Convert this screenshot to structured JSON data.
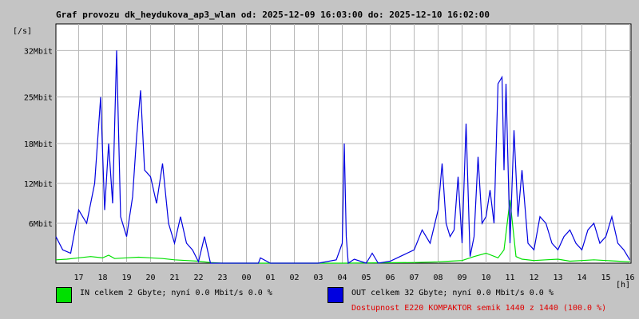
{
  "chart_data": {
    "type": "line",
    "title": "Graf provozu dk_heydukova_ap3_wlan od: 2025-12-09 16:03:00 do: 2025-12-10 16:02:00",
    "ylabel": "[/s]",
    "xlabel": "[h]",
    "ylim": [
      0,
      36
    ],
    "y_unit": "Mbit",
    "y_ticks": [
      {
        "value": 6,
        "label": "6Mbit"
      },
      {
        "value": 12,
        "label": "12Mbit"
      },
      {
        "value": 18,
        "label": "18Mbit"
      },
      {
        "value": 25,
        "label": "25Mbit"
      },
      {
        "value": 32,
        "label": "32Mbit"
      }
    ],
    "x_ticks": [
      "17",
      "18",
      "19",
      "20",
      "21",
      "22",
      "23",
      "00",
      "01",
      "02",
      "03",
      "04",
      "05",
      "06",
      "07",
      "08",
      "09",
      "10",
      "11",
      "12",
      "13",
      "14",
      "15",
      "16"
    ],
    "grid": true,
    "series": [
      {
        "name": "IN",
        "color": "#00e000",
        "x": [
          "16:03",
          "16:30",
          "17:00",
          "17:30",
          "18:00",
          "18:15",
          "18:30",
          "19:00",
          "19:30",
          "20:00",
          "20:30",
          "21:00",
          "21:30",
          "22:00",
          "22:30",
          "23:00",
          "04:00",
          "07:00",
          "08:00",
          "08:30",
          "09:00",
          "09:30",
          "10:00",
          "10:30",
          "10:45",
          "11:00",
          "11:15",
          "11:30",
          "12:00",
          "12:30",
          "13:00",
          "13:30",
          "14:00",
          "14:30",
          "15:00",
          "15:30",
          "16:00"
        ],
        "values": [
          0.5,
          0.6,
          0.8,
          1.0,
          0.8,
          1.2,
          0.7,
          0.8,
          0.9,
          0.8,
          0.7,
          0.5,
          0.4,
          0.3,
          0.1,
          0.0,
          0.0,
          0.1,
          0.2,
          0.3,
          0.4,
          1.0,
          1.5,
          0.8,
          2.0,
          9.5,
          1.0,
          0.6,
          0.4,
          0.5,
          0.6,
          0.3,
          0.4,
          0.5,
          0.4,
          0.3,
          0.2
        ]
      },
      {
        "name": "OUT",
        "color": "#0000e0",
        "x": [
          "16:03",
          "16:20",
          "16:40",
          "17:00",
          "17:20",
          "17:40",
          "17:55",
          "18:05",
          "18:15",
          "18:25",
          "18:35",
          "18:45",
          "19:00",
          "19:15",
          "19:25",
          "19:35",
          "19:45",
          "20:00",
          "20:15",
          "20:30",
          "20:45",
          "21:00",
          "21:15",
          "21:30",
          "21:45",
          "22:00",
          "22:15",
          "22:30",
          "22:45",
          "23:00",
          "00:00",
          "00:30",
          "00:35",
          "01:00",
          "03:00",
          "03:45",
          "04:00",
          "04:05",
          "04:10",
          "04:15",
          "04:30",
          "05:00",
          "05:15",
          "05:30",
          "06:00",
          "07:00",
          "07:20",
          "07:40",
          "08:00",
          "08:10",
          "08:20",
          "08:30",
          "08:40",
          "08:50",
          "09:00",
          "09:10",
          "09:20",
          "09:30",
          "09:40",
          "09:50",
          "10:00",
          "10:10",
          "10:20",
          "10:30",
          "10:40",
          "10:45",
          "10:50",
          "11:00",
          "11:10",
          "11:20",
          "11:30",
          "11:45",
          "12:00",
          "12:15",
          "12:30",
          "12:45",
          "13:00",
          "13:15",
          "13:30",
          "13:45",
          "14:00",
          "14:15",
          "14:30",
          "14:45",
          "15:00",
          "15:15",
          "15:30",
          "15:45",
          "16:00"
        ],
        "values": [
          4,
          2,
          1.5,
          8,
          6,
          12,
          25,
          8,
          18,
          9,
          32,
          7,
          4,
          10,
          19,
          26,
          14,
          13,
          9,
          15,
          6,
          3,
          7,
          3,
          2,
          0.2,
          4,
          0,
          0,
          0,
          0,
          0,
          0.8,
          0,
          0,
          0.5,
          3,
          18,
          4,
          0,
          0.6,
          0,
          1.5,
          0,
          0.3,
          2,
          5,
          3,
          8,
          15,
          6,
          4,
          5,
          13,
          3,
          21,
          1,
          4,
          16,
          6,
          7,
          11,
          6,
          27,
          28,
          14,
          27,
          3,
          20,
          7,
          14,
          3,
          2,
          7,
          6,
          3,
          2,
          4,
          5,
          3,
          2,
          5,
          6,
          3,
          4,
          7,
          3,
          2,
          0.5
        ]
      }
    ],
    "legend": [
      {
        "color": "#00e000",
        "label": "IN celkem 2 Gbyte; nyní    0.0 Mbit/s 0.0 %"
      },
      {
        "color": "#0000e0",
        "label": "OUT celkem 32 Gbyte; nyní    0.0 Mbit/s 0.0 %"
      }
    ],
    "availability": "Dostupnost E220 KOMPAKTOR semik 1440 z 1440 (100.0 %)"
  }
}
